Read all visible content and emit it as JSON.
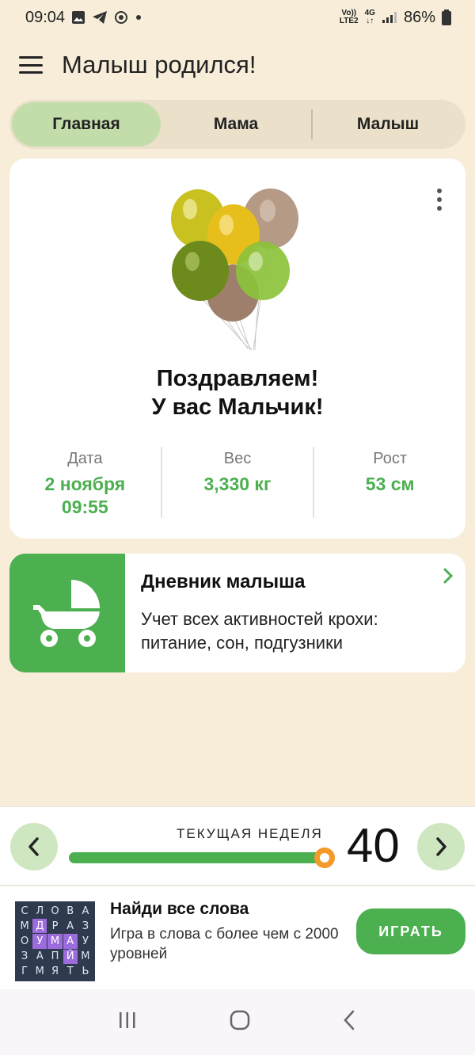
{
  "status": {
    "time": "09:04",
    "net_top": "Vo))",
    "net_bottom": "LTE2",
    "net_type": "4G",
    "battery": "86%"
  },
  "header": {
    "title": "Малыш родился!"
  },
  "tabs": [
    {
      "label": "Главная",
      "active": true
    },
    {
      "label": "Мама",
      "active": false
    },
    {
      "label": "Малыш",
      "active": false
    }
  ],
  "main_card": {
    "congrats_line1": "Поздравляем!",
    "congrats_line2": "У вас Мальчик!",
    "stats": [
      {
        "label": "Дата",
        "value": "2 ноября",
        "value2": "09:55"
      },
      {
        "label": "Вес",
        "value": "3,330  кг"
      },
      {
        "label": "Рост",
        "value": "53 см"
      }
    ]
  },
  "diary": {
    "title": "Дневник малыша",
    "description": "Учет всех активностей крохи: питание, сон, подгузники"
  },
  "week": {
    "label": "ТЕКУЩАЯ НЕДЕЛЯ",
    "number": "40",
    "progress": 0.97
  },
  "ad": {
    "title": "Найди все слова",
    "description": "Игра в слова с более чем с 2000 уровней",
    "button": "ИГРАТЬ",
    "grid": [
      [
        "С",
        "Л",
        "О",
        "В",
        "А"
      ],
      [
        "М",
        "Д",
        "Р",
        "А",
        "З"
      ],
      [
        "О",
        "У",
        "М",
        "А",
        "У"
      ],
      [
        "З",
        "А",
        "П",
        "Й",
        "М"
      ],
      [
        "Г",
        "М",
        "Я",
        "Т",
        "Ь"
      ]
    ],
    "highlighted": [
      [
        1,
        1
      ],
      [
        2,
        1
      ],
      [
        2,
        2
      ],
      [
        2,
        3
      ],
      [
        3,
        3
      ]
    ]
  },
  "colors": {
    "accent": "#4caf50",
    "background": "#f7edd9",
    "tab_active": "#c2ddaa",
    "knob": "#f39a2b"
  }
}
